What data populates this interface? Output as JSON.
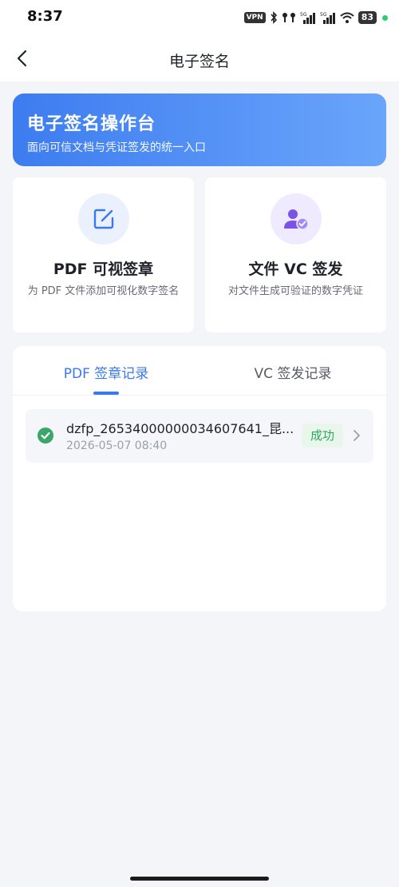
{
  "status_bar": {
    "time": "8:37",
    "vpn": "VPN",
    "signal1_label": "5G",
    "signal2_label": "5G",
    "battery": "83"
  },
  "nav": {
    "title": "电子签名"
  },
  "banner": {
    "title": "电子签名操作台",
    "subtitle": "面向可信文档与凭证签发的统一入口"
  },
  "cards": {
    "pdf": {
      "title": "PDF 可视签章",
      "desc": "为 PDF 文件添加可视化数字签名",
      "icon": "edit-icon"
    },
    "vc": {
      "title": "文件 VC 签发",
      "desc": "对文件生成可验证的数字凭证",
      "icon": "user-check-icon"
    }
  },
  "tabs": {
    "pdf_records": "PDF 签章记录",
    "vc_records": "VC 签发记录",
    "active": "pdf_records"
  },
  "records": [
    {
      "name": "dzfp_26534000000034607641_昆...",
      "time": "2026-05-07 08:40",
      "status": "成功"
    }
  ],
  "colors": {
    "accent": "#3a78f0",
    "success": "#2fa860",
    "banner_start": "#3d7cf0",
    "banner_end": "#6aa5fb"
  }
}
